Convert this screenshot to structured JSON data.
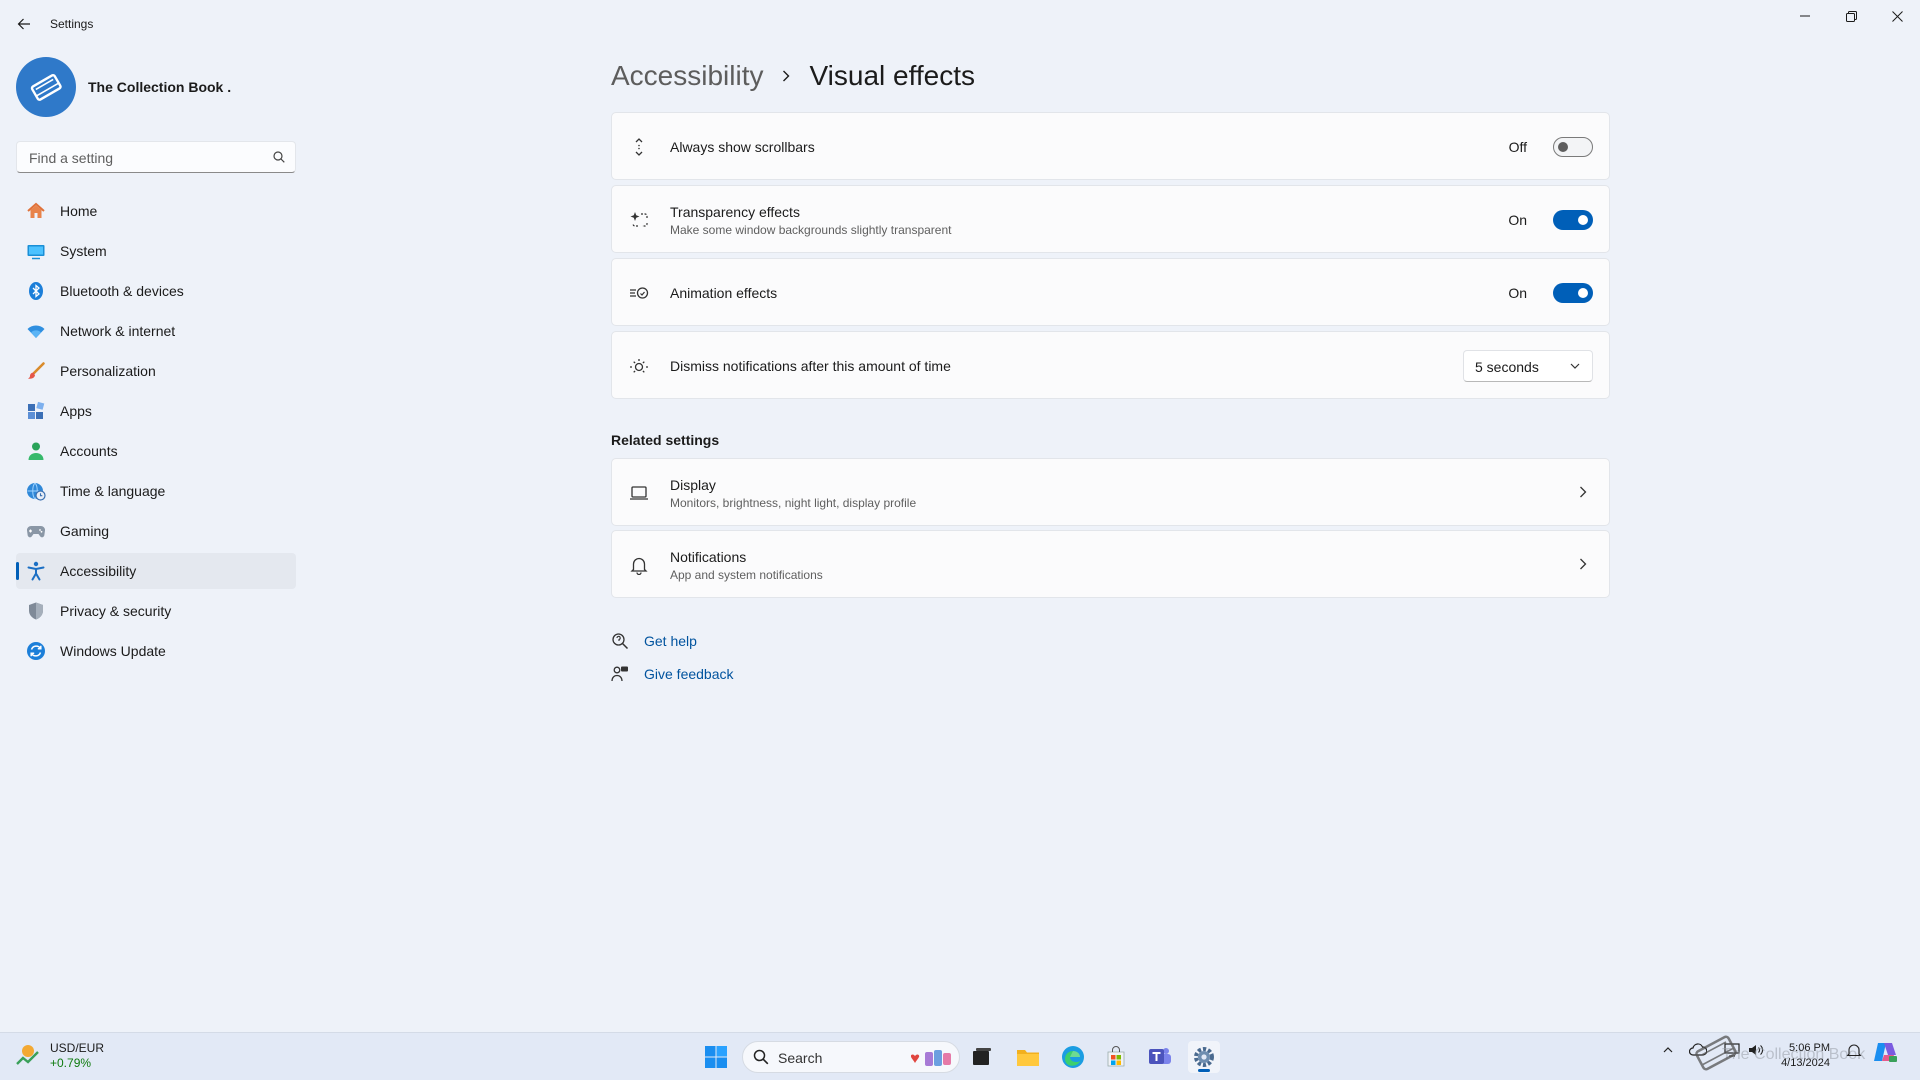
{
  "app": {
    "title": "Settings"
  },
  "profile": {
    "name": "The Collection Book ."
  },
  "search": {
    "placeholder": "Find a setting"
  },
  "nav": {
    "items": [
      {
        "label": "Home"
      },
      {
        "label": "System"
      },
      {
        "label": "Bluetooth & devices"
      },
      {
        "label": "Network & internet"
      },
      {
        "label": "Personalization"
      },
      {
        "label": "Apps"
      },
      {
        "label": "Accounts"
      },
      {
        "label": "Time & language"
      },
      {
        "label": "Gaming"
      },
      {
        "label": "Accessibility",
        "active": true
      },
      {
        "label": "Privacy & security"
      },
      {
        "label": "Windows Update"
      }
    ]
  },
  "breadcrumb": {
    "parent": "Accessibility",
    "current": "Visual effects"
  },
  "settings": {
    "scrollbars": {
      "title": "Always show scrollbars",
      "state": "Off",
      "on": false
    },
    "transparency": {
      "title": "Transparency effects",
      "subtitle": "Make some window backgrounds slightly transparent",
      "state": "On",
      "on": true
    },
    "animation": {
      "title": "Animation effects",
      "state": "On",
      "on": true
    },
    "dismiss": {
      "title": "Dismiss notifications after this amount of time",
      "value": "5 seconds"
    }
  },
  "related": {
    "title": "Related settings",
    "display": {
      "title": "Display",
      "subtitle": "Monitors, brightness, night light, display profile"
    },
    "notifications": {
      "title": "Notifications",
      "subtitle": "App and system notifications"
    }
  },
  "help": {
    "get_help": "Get help",
    "give_feedback": "Give feedback"
  },
  "taskbar": {
    "widget": {
      "title": "USD/EUR",
      "value": "+0.79%"
    },
    "search_label": "Search",
    "clock": {
      "time": "5:06 PM",
      "date": "4/13/2024"
    },
    "watermark": "The Collection Book"
  },
  "colors": {
    "accent": "#005fb8",
    "background": "#eef2f9",
    "positive": "#0f7b0f",
    "link": "#00539e"
  }
}
